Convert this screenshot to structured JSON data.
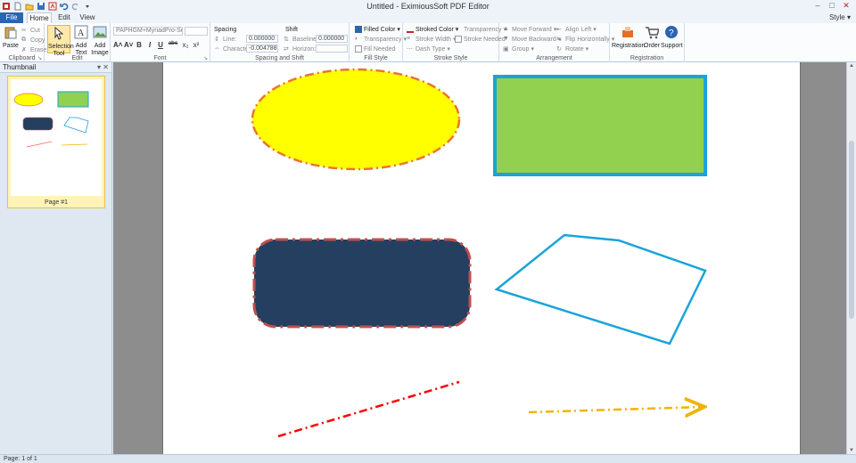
{
  "window": {
    "title": "Untitled - EximiousSoft PDF Editor"
  },
  "tabs": {
    "file": "File",
    "home": "Home",
    "edit": "Edit",
    "view": "View",
    "style_menu": "Style ▾"
  },
  "ribbon": {
    "clipboard": {
      "label": "Clipboard",
      "paste": "Paste",
      "cut": "Cut",
      "copy": "Copy",
      "erase": "Erase"
    },
    "edit": {
      "label": "Edit",
      "selection_tool": "Selection Tool",
      "add_text": "Add Text",
      "add_image": "Add Image"
    },
    "font": {
      "label": "Font",
      "font_name": "PAPHGM+MyriadPro-Semil",
      "font_size": "",
      "buttons": [
        "A˄",
        "A˅",
        "B",
        "I",
        "U",
        "abc",
        "x₂",
        "x²"
      ]
    },
    "spacing_shift": {
      "label": "Spacing and Shift",
      "spacing_title": "Spacing",
      "shift_title": "Shift",
      "line_label": "Line:",
      "line_value": "0.000000",
      "character_label": "Character:",
      "character_value": "-0.004788",
      "baseline_label": "Baseline:",
      "baseline_value": "0.000000",
      "horizon_label": "Horizon:",
      "horizon_value": ""
    },
    "fill_style": {
      "label": "Fill Style",
      "filled_color": "Filled Color",
      "transparency": "Transparency",
      "fill_needed": "Fill Needed"
    },
    "stroke_style": {
      "label": "Stroke Style",
      "stroked_color": "Stroked Color",
      "stroke_width": "Stroke Width",
      "dash_type": "Dash Type",
      "transparency": "Transparency",
      "stroke_needed": "Stroke Needed"
    },
    "arrangement": {
      "label": "Arrangement",
      "move_forward": "Move Forward",
      "move_backward": "Move Backward",
      "group": "Group",
      "align_left": "Align Left",
      "flip_horizontally": "Flip Horizontally",
      "rotate": "Rotate"
    },
    "registration": {
      "label": "Registration",
      "registration": "Registration",
      "order": "Order",
      "support": "Support"
    }
  },
  "thumbnail_panel": {
    "title": "Thumbnail",
    "pages": [
      {
        "caption": "Page #1"
      }
    ]
  },
  "statusbar": {
    "text": "Page: 1 of 1"
  },
  "canvas_shapes": [
    {
      "name": "ellipse",
      "fill": "#ffff00",
      "stroke": "#e8762c",
      "dash": "dash-dot"
    },
    {
      "name": "rectangle",
      "fill": "#92d050",
      "stroke": "#1aa3d9",
      "dash": "solid"
    },
    {
      "name": "rounded-rectangle",
      "fill": "#243f60",
      "stroke": "#c0504d",
      "dash": "dash-dot"
    },
    {
      "name": "polygon",
      "fill": "none",
      "stroke": "#1aa3d9",
      "dash": "solid"
    },
    {
      "name": "line",
      "stroke": "#ff0000",
      "dash": "dash-dot"
    },
    {
      "name": "arrow",
      "stroke": "#f0b400",
      "dash": "dash-dot"
    }
  ]
}
